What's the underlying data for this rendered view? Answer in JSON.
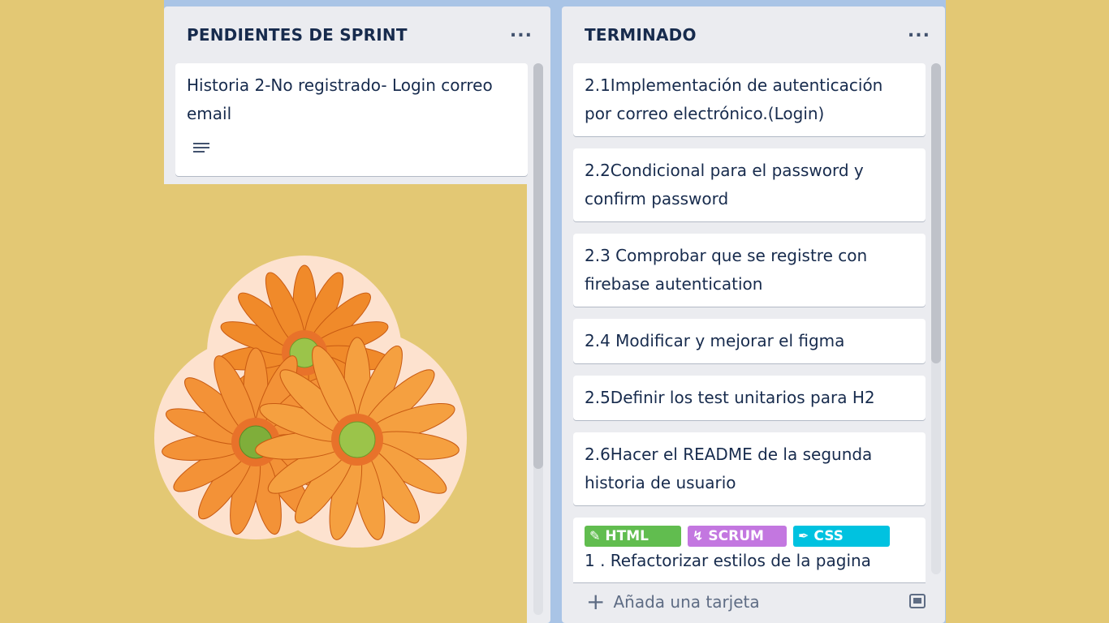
{
  "lists": {
    "pending": {
      "title": "PENDIENTES DE SPRINT",
      "menu": "...",
      "cards": [
        {
          "text": "Historia 2-No registrado- Login correo email",
          "icon": "description-icon"
        }
      ]
    },
    "done": {
      "title": "TERMINADO",
      "menu": "...",
      "cards": [
        {
          "text": "2.1Implementación de autenticación por correo electrónico.(Login)"
        },
        {
          "text": "2.2Condicional para el password y confirm password"
        },
        {
          "text": "2.3 Comprobar que se registre con firebase autentication"
        },
        {
          "text": "2.4 Modificar y mejorar el figma"
        },
        {
          "text": "2.5Definir los test unitarios para H2"
        },
        {
          "text": "2.6Hacer el README de la segunda historia de usuario"
        },
        {
          "labels": [
            {
              "text": "HTML",
              "color": "#61bd4f",
              "icon": "pencil-icon"
            },
            {
              "text": "SCRUM",
              "color": "#c377e0",
              "icon": "scrum-icon"
            },
            {
              "text": "CSS",
              "color": "#00c2e0",
              "icon": "brush-icon"
            }
          ],
          "text": "1 . Refactorizar estilos de la pagina"
        }
      ],
      "add_card": "Añada una tarjeta"
    }
  },
  "colors": {
    "background": "#e3c874",
    "list": "#ebecf0",
    "card": "#ffffff",
    "flower": "#f08a2a"
  }
}
